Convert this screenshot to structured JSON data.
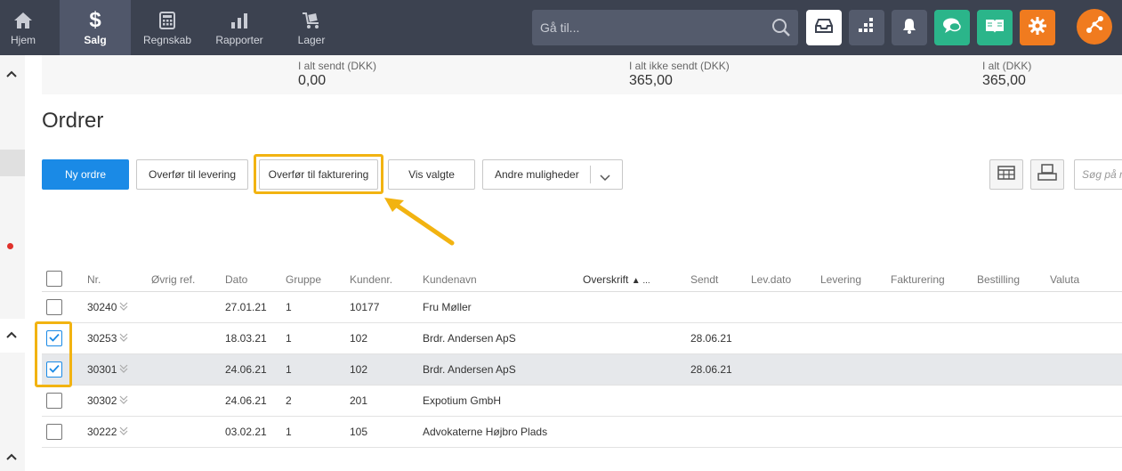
{
  "nav": {
    "items": [
      {
        "label": "Hjem",
        "icon": "home-icon"
      },
      {
        "label": "Salg",
        "icon": "dollar-icon"
      },
      {
        "label": "Regnskab",
        "icon": "calculator-icon"
      },
      {
        "label": "Rapporter",
        "icon": "bar-chart-icon"
      },
      {
        "label": "Lager",
        "icon": "cart-icon"
      }
    ],
    "search_placeholder": "Gå til...",
    "colors": {
      "bar": "#3c4250",
      "active": "#50576a",
      "green": "#2bb58a",
      "orange": "#f07b1f"
    }
  },
  "summary": {
    "sent_label": "I alt sendt (DKK)",
    "sent_value": "0,00",
    "not_sent_label": "I alt ikke sendt (DKK)",
    "not_sent_value": "365,00",
    "total_label": "I alt (DKK)",
    "total_value": "365,00"
  },
  "page_title": "Ordrer",
  "toolbar": {
    "new_order": "Ny ordre",
    "transfer_delivery": "Overfør til levering",
    "transfer_invoicing": "Overfør til fakturering",
    "show_selected": "Vis valgte",
    "other_options": "Andre muligheder",
    "search_placeholder": "Søg på nr."
  },
  "table": {
    "headers": {
      "nr": "Nr.",
      "other_ref": "Øvrig ref.",
      "date": "Dato",
      "group": "Gruppe",
      "customer_no": "Kundenr.",
      "customer_name": "Kundenavn",
      "heading": "Overskrift",
      "sent": "Sendt",
      "delivery_date": "Lev.dato",
      "delivery": "Levering",
      "invoicing": "Fakturering",
      "ordering": "Bestilling",
      "currency": "Valuta"
    },
    "sort_indicator": "▲ ...",
    "rows": [
      {
        "nr": "30240",
        "date": "27.01.21",
        "group": "1",
        "customer_no": "10177",
        "customer_name": "Fru Møller",
        "sent": "",
        "checked": false
      },
      {
        "nr": "30253",
        "date": "18.03.21",
        "group": "1",
        "customer_no": "102",
        "customer_name": "Brdr. Andersen ApS",
        "sent": "28.06.21",
        "checked": true
      },
      {
        "nr": "30301",
        "date": "24.06.21",
        "group": "1",
        "customer_no": "102",
        "customer_name": "Brdr. Andersen ApS",
        "sent": "28.06.21",
        "checked": true
      },
      {
        "nr": "30302",
        "date": "24.06.21",
        "group": "2",
        "customer_no": "201",
        "customer_name": "Expotium GmbH",
        "sent": "",
        "checked": false
      },
      {
        "nr": "30222",
        "date": "03.02.21",
        "group": "1",
        "customer_no": "105",
        "customer_name": "Advokaterne Højbro Plads",
        "sent": "",
        "checked": false
      }
    ]
  }
}
